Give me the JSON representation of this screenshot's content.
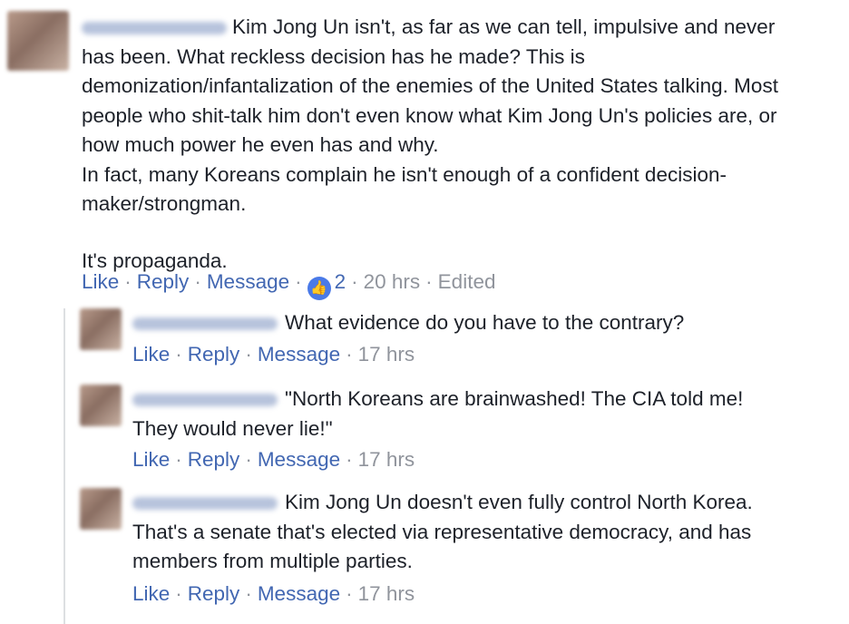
{
  "main_comment": {
    "avatar": "blurred-profile-photo",
    "author_blurred": true,
    "lines": [
      "Kim Jong Un isn't, as far as we can tell, impulsive and never",
      "has been. What reckless decision has he made? This is",
      "demonization/infantalization of the enemies of the United States talking. Most",
      "people who shit-talk him don't even know what Kim Jong Un's policies are, or",
      "how much power he even has and why.",
      "In fact, many Koreans complain he isn't enough of a confident decision-",
      "maker/strongman."
    ],
    "last_paragraph": "It's propaganda.",
    "actions": {
      "like": "Like",
      "reply": "Reply",
      "message": "Message",
      "reaction_icon": "thumbs-up-icon",
      "reaction_count": "2",
      "time": "20 hrs",
      "edited": "Edited"
    }
  },
  "replies": [
    {
      "lines": [
        "What evidence do you have to the contrary?"
      ],
      "actions": {
        "like": "Like",
        "reply": "Reply",
        "message": "Message",
        "time": "17 hrs"
      }
    },
    {
      "lines": [
        "\"North Koreans are brainwashed! The CIA told me!",
        "They would never lie!\""
      ],
      "actions": {
        "like": "Like",
        "reply": "Reply",
        "message": "Message",
        "time": "17 hrs"
      }
    },
    {
      "lines": [
        "Kim Jong Un doesn't even fully control North Korea.",
        "That's a senate that's elected via representative democracy, and has",
        "members from multiple parties."
      ],
      "actions": {
        "like": "Like",
        "reply": "Reply",
        "message": "Message",
        "time": "17 hrs"
      }
    }
  ],
  "colors": {
    "link": "#4267b2",
    "meta": "#90949c",
    "text": "#1d2129",
    "reaction": "#4a7ae8"
  }
}
